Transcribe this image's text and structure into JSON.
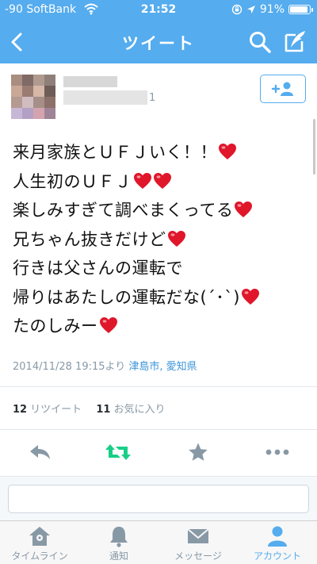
{
  "status_bar": {
    "carrier": "-90 SoftBank",
    "time": "21:52",
    "battery": "91%",
    "battery_level": 0.91
  },
  "nav": {
    "title": "ツイート",
    "back_icon": "chevron-left-icon",
    "search_icon": "search-icon",
    "compose_icon": "compose-icon"
  },
  "author": {
    "handle_tail": "1",
    "follow_icon": "add-user-icon"
  },
  "tweet": {
    "lines": [
      {
        "text": "来月家族とＵＦＪいく！！",
        "hearts": 1
      },
      {
        "text": "人生初のＵＦＪ",
        "hearts": 2
      },
      {
        "text": "楽しみすぎて調べまくってる",
        "hearts": 1
      },
      {
        "text": "兄ちゃん抜きだけど",
        "hearts": 1
      },
      {
        "text": "行きは父さんの運転で",
        "hearts": 0
      },
      {
        "text": "帰りはあたしの運転だな(ˊ･ˋ)",
        "hearts": 1
      },
      {
        "text": "たのしみー",
        "hearts": 1
      }
    ],
    "timestamp": "2014/11/28 19:15より",
    "location": "津島市, 愛知県"
  },
  "stats": {
    "retweets_count": "12",
    "retweets_label": "リツイート",
    "favorites_count": "11",
    "favorites_label": "お気に入り"
  },
  "reply": {
    "placeholder": ""
  },
  "tabbar": {
    "tabs": [
      {
        "label": "タイムライン",
        "icon": "home-icon"
      },
      {
        "label": "通知",
        "icon": "bell-icon"
      },
      {
        "label": "メッセージ",
        "icon": "envelope-icon"
      },
      {
        "label": "アカウント",
        "icon": "person-icon"
      }
    ],
    "active_index": 3
  },
  "colors": {
    "brand": "#55acee",
    "heart": "#e0162b",
    "retweet_green": "#19cf86",
    "muted": "#8899a6"
  }
}
